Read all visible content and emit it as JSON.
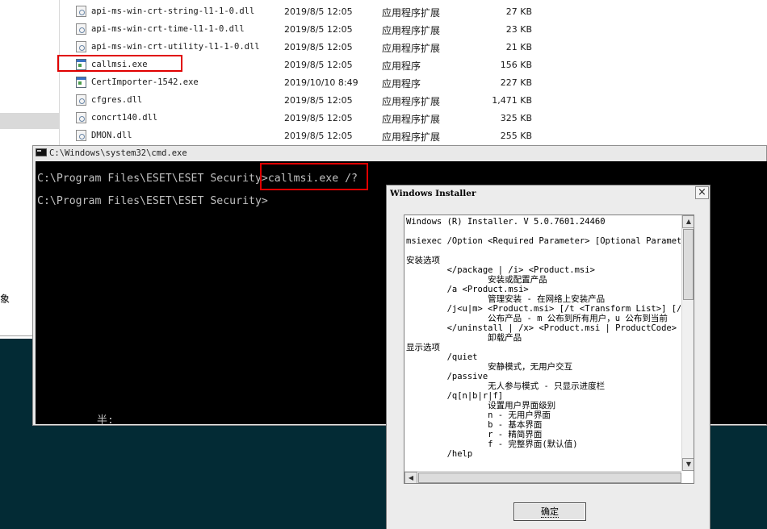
{
  "explorer": {
    "files": [
      {
        "name": "api-ms-win-crt-string-l1-1-0.dll",
        "date": "2019/8/5 12:05",
        "type": "应用程序扩展",
        "size": "27 KB",
        "icon": "dll-file-icon"
      },
      {
        "name": "api-ms-win-crt-time-l1-1-0.dll",
        "date": "2019/8/5 12:05",
        "type": "应用程序扩展",
        "size": "23 KB",
        "icon": "dll-file-icon"
      },
      {
        "name": "api-ms-win-crt-utility-l1-1-0.dll",
        "date": "2019/8/5 12:05",
        "type": "应用程序扩展",
        "size": "21 KB",
        "icon": "dll-file-icon"
      },
      {
        "name": "callmsi.exe",
        "date": "2019/8/5 12:05",
        "type": "应用程序",
        "size": "156 KB",
        "icon": "exe-file-icon"
      },
      {
        "name": "CertImporter-1542.exe",
        "date": "2019/10/10 8:49",
        "type": "应用程序",
        "size": "227 KB",
        "icon": "exe-file-icon"
      },
      {
        "name": "cfgres.dll",
        "date": "2019/8/5 12:05",
        "type": "应用程序扩展",
        "size": "1,471 KB",
        "icon": "dll-file-icon"
      },
      {
        "name": "concrt140.dll",
        "date": "2019/8/5 12:05",
        "type": "应用程序扩展",
        "size": "325 KB",
        "icon": "dll-file-icon"
      },
      {
        "name": "DMON.dll",
        "date": "2019/8/5 12:05",
        "type": "应用程序扩展",
        "size": "255 KB",
        "icon": "dll-file-icon"
      }
    ],
    "sidebar_fragment": "象"
  },
  "cmd": {
    "title": "C:\\Windows\\system32\\cmd.exe",
    "prompt1": "C:\\Program Files\\ESET\\ESET Security>",
    "command": "callmsi.exe /?",
    "prompt2": "C:\\Program Files\\ESET\\ESET Security>",
    "ime_indicator": "半:"
  },
  "installer": {
    "title": "Windows Installer",
    "close_label": "×",
    "lines": [
      "Windows (R) Installer. V 5.0.7601.24460",
      "",
      "msiexec /Option <Required Parameter> [Optional Parameter]",
      "",
      "安装选项",
      "        </package | /i> <Product.msi>",
      "                安装或配置产品",
      "        /a <Product.msi>",
      "                管理安装 - 在网络上安装产品",
      "        /j<u|m> <Product.msi> [/t <Transform List>] [/g <",
      "                公布产品 - m 公布到所有用户，u 公布到当前",
      "        </uninstall | /x> <Product.msi | ProductCode>",
      "                卸载产品",
      "显示选项",
      "        /quiet",
      "                安静模式，无用户交互",
      "        /passive",
      "                无人参与模式 - 只显示进度栏",
      "        /q[n|b|r|f]",
      "                设置用户界面级别",
      "                n - 无用户界面",
      "                b - 基本界面",
      "                r - 精简界面",
      "                f - 完整界面(默认值)",
      "        /help"
    ],
    "ok_label": "确定"
  },
  "colors": {
    "highlight": "#e00000",
    "console_bg": "#000000",
    "console_fg": "#c0c0c0",
    "desktop_bg": "#032b35"
  }
}
